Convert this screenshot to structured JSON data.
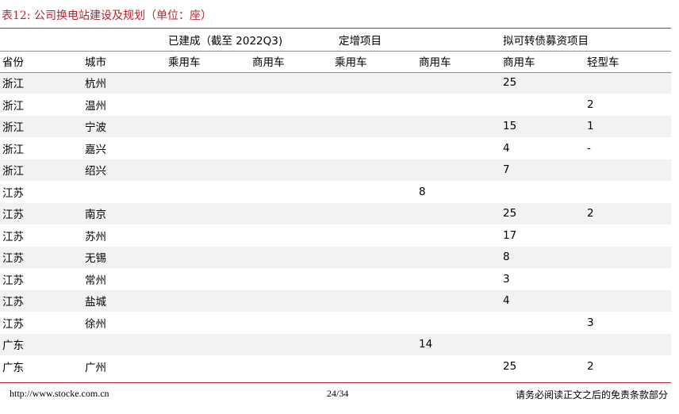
{
  "caption": "表12:  公司换电站建设及规划（单位：座）",
  "groups": {
    "built": "已建成（截至 2022Q3)",
    "placement": "定增项目",
    "convertible": "拟可转债募资项目"
  },
  "columns": [
    "省份",
    "城市",
    "乘用车",
    "商用车",
    "乘用车",
    "商用车",
    "商用车",
    "轻型车"
  ],
  "rows": [
    [
      "浙江",
      "杭州",
      "",
      "",
      "",
      "",
      "25",
      ""
    ],
    [
      "浙江",
      "温州",
      "",
      "",
      "",
      "",
      "",
      "2"
    ],
    [
      "浙江",
      "宁波",
      "",
      "",
      "",
      "",
      "15",
      "1"
    ],
    [
      "浙江",
      "嘉兴",
      "",
      "",
      "",
      "",
      "4",
      "-"
    ],
    [
      "浙江",
      "绍兴",
      "",
      "",
      "",
      "",
      "7",
      ""
    ],
    [
      "江苏",
      "",
      "",
      "",
      "",
      "8",
      "",
      ""
    ],
    [
      "江苏",
      "南京",
      "",
      "",
      "",
      "",
      "25",
      "2"
    ],
    [
      "江苏",
      "苏州",
      "",
      "",
      "",
      "",
      "17",
      ""
    ],
    [
      "江苏",
      "无锡",
      "",
      "",
      "",
      "",
      "8",
      ""
    ],
    [
      "江苏",
      "常州",
      "",
      "",
      "",
      "",
      "3",
      ""
    ],
    [
      "江苏",
      "盐城",
      "",
      "",
      "",
      "",
      "4",
      ""
    ],
    [
      "江苏",
      "徐州",
      "",
      "",
      "",
      "",
      "",
      "3"
    ],
    [
      "广东",
      "",
      "",
      "",
      "",
      "14",
      "",
      ""
    ],
    [
      "广东",
      "广州",
      "",
      "",
      "",
      "",
      "25",
      "2"
    ]
  ],
  "footer": {
    "url": "http://www.stocke.com.cn",
    "page": "24/34",
    "disclaimer": "请务必阅读正文之后的免责条款部分"
  }
}
